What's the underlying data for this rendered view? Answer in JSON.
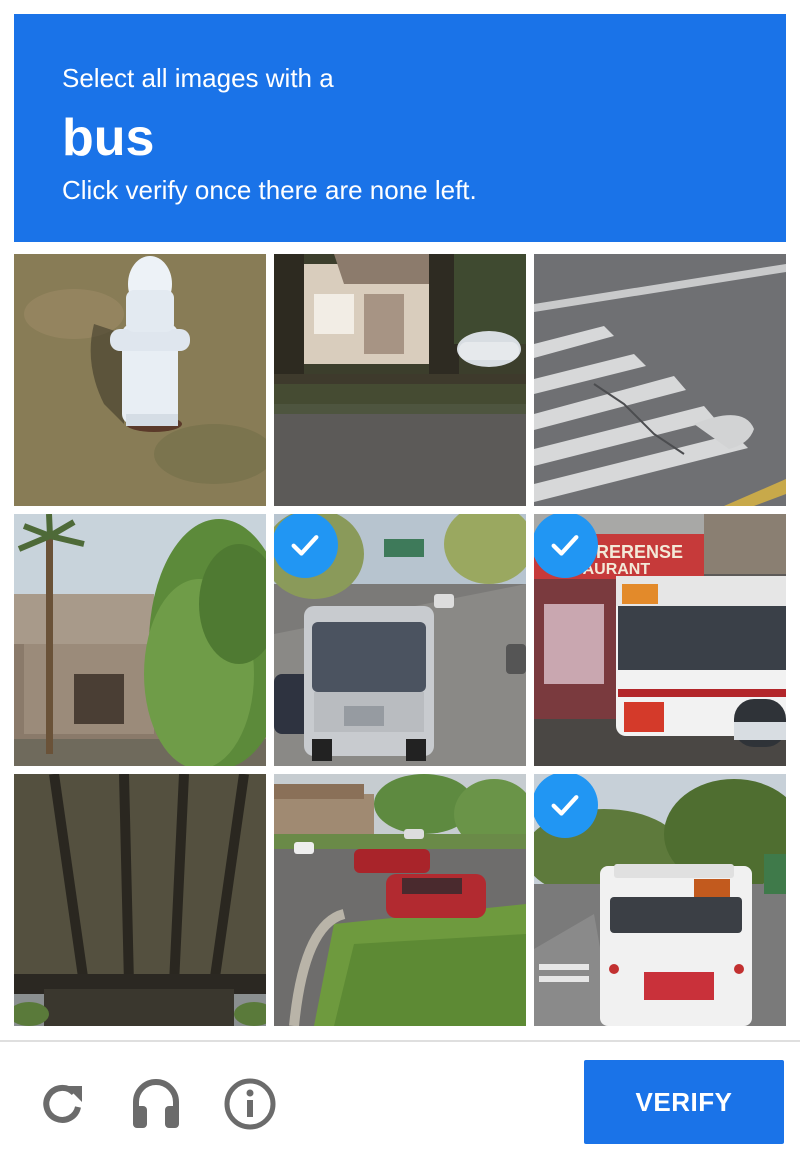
{
  "challenge": {
    "instruction": "Select all images with a",
    "target": "bus",
    "subtext": "Click verify once there are none left."
  },
  "tiles": [
    {
      "index": 0,
      "scene": "fire-hydrant",
      "selected": false
    },
    {
      "index": 1,
      "scene": "house-with-trees",
      "selected": false
    },
    {
      "index": 2,
      "scene": "road-crosswalk",
      "selected": false
    },
    {
      "index": 3,
      "scene": "palm-tree-building",
      "selected": false
    },
    {
      "index": 4,
      "scene": "bus-on-street",
      "selected": true
    },
    {
      "index": 5,
      "scene": "bus-at-restaurant",
      "selected": true
    },
    {
      "index": 6,
      "scene": "bridge-underside",
      "selected": false
    },
    {
      "index": 7,
      "scene": "parking-lot",
      "selected": false
    },
    {
      "index": 8,
      "scene": "bus-rear-view",
      "selected": true
    }
  ],
  "footer": {
    "reload_icon": "reload-icon",
    "audio_icon": "headphones-icon",
    "info_icon": "info-icon",
    "verify_label": "VERIFY"
  },
  "colors": {
    "accent": "#1a73e8",
    "check_badge": "#2196f3"
  }
}
